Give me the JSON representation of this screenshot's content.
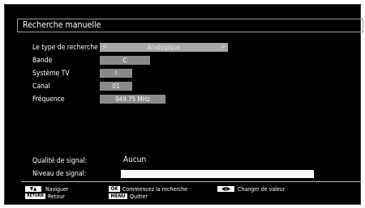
{
  "title": "Recherche manuelle",
  "rows": {
    "search_type": {
      "label": "Le type de recherche",
      "value": "Analogique",
      "left_arrow": "<",
      "right_arrow": ">"
    },
    "band": {
      "label": "Bande",
      "value": "C"
    },
    "tv_system": {
      "label": "Système TV",
      "value": "I"
    },
    "channel": {
      "label": "Canal",
      "value": "01"
    },
    "frequency": {
      "label": "Fréquence",
      "value": "049.75 MHz"
    }
  },
  "signal": {
    "quality_label": "Qualité de signal:",
    "quality_value": "Aucun",
    "level_label": "Niveau de signal:",
    "level_fraction": 1.0
  },
  "footer": {
    "navigate_keys": "▼▲",
    "navigate_label": "Naviguer",
    "return_key": "RETURN",
    "return_label": "Retour",
    "ok_key": "OK",
    "ok_label": "Commencez la recherche",
    "menu_key": "MENU",
    "menu_label": "Quitter",
    "change_keys": "◀▮▶",
    "change_label": "Changer de valeur"
  },
  "colors": {
    "background": "#000000",
    "text": "#ffffff",
    "value_box": "#8a8a8a",
    "selected_box": "#a8a8a8"
  }
}
